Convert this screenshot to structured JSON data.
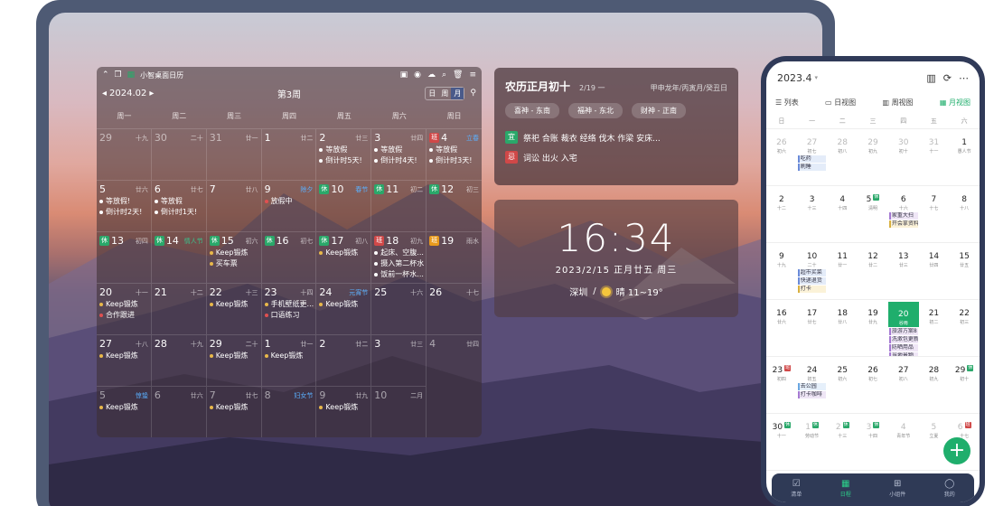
{
  "calendar": {
    "app_title": "小智桌面日历",
    "month": "2024.02",
    "week": "第3周",
    "view_tabs": [
      "日",
      "周",
      "月"
    ],
    "weekdays": [
      "周一",
      "周二",
      "周三",
      "周四",
      "周五",
      "周六",
      "周日"
    ],
    "cells": [
      {
        "d": "29",
        "l": "十九",
        "dim": true
      },
      {
        "d": "30",
        "l": "二十",
        "dim": true
      },
      {
        "d": "31",
        "l": "廿一",
        "dim": true
      },
      {
        "d": "1",
        "l": "廿二"
      },
      {
        "d": "2",
        "l": "廿三",
        "ev": [
          [
            "等放假",
            "w"
          ],
          [
            "倒计时5天!",
            "w"
          ]
        ]
      },
      {
        "d": "3",
        "l": "廿四",
        "ev": [
          [
            "等放假",
            "w"
          ],
          [
            "倒计时4天!",
            "w"
          ]
        ]
      },
      {
        "d": "4",
        "l": "立春",
        "fest": true,
        "tag": "班",
        "tc": "b",
        "ev": [
          [
            "等放假",
            "w"
          ],
          [
            "倒计时3天!",
            "w"
          ]
        ]
      },
      {
        "d": "5",
        "l": "廿六",
        "ev": [
          [
            "等放假!",
            "w"
          ],
          [
            "倒计时2天!",
            "w"
          ]
        ]
      },
      {
        "d": "6",
        "l": "廿七",
        "ev": [
          [
            "等放假",
            "w"
          ],
          [
            "倒计时1天!",
            "w"
          ]
        ]
      },
      {
        "d": "7",
        "l": "廿八"
      },
      {
        "d": "9",
        "l": "除夕",
        "fest": true,
        "ev": [
          [
            "放假中",
            "r"
          ]
        ]
      },
      {
        "d": "10",
        "l": "春节",
        "fest": true,
        "tag": "休",
        "tc": "x"
      },
      {
        "d": "11",
        "l": "初二",
        "tag": "休",
        "tc": "x"
      },
      {
        "d": "12",
        "l": "初三",
        "tag": "休",
        "tc": "x"
      },
      {
        "d": "13",
        "l": "初四",
        "tag": "休",
        "tc": "x"
      },
      {
        "d": "14",
        "l": "情人节",
        "fest2": true,
        "tag": "休",
        "tc": "x"
      },
      {
        "d": "15",
        "l": "初六",
        "tag": "休",
        "tc": "x",
        "ev": [
          [
            "Keep锻炼",
            ""
          ],
          [
            "买车票",
            ""
          ]
        ]
      },
      {
        "d": "16",
        "l": "初七",
        "tag": "休",
        "tc": "x"
      },
      {
        "d": "17",
        "l": "初八",
        "tag": "休",
        "tc": "x",
        "ev": [
          [
            "Keep锻炼",
            ""
          ]
        ]
      },
      {
        "d": "18",
        "l": "初九",
        "tag": "班",
        "tc": "b",
        "ev": [
          [
            "起床、空腹...",
            "w"
          ],
          [
            "摄入第二杯水",
            "w"
          ],
          [
            "饭前一杯水...",
            "w"
          ]
        ]
      },
      {
        "d": "19",
        "l": "雨水",
        "tag": "班",
        "tc": "o"
      },
      {
        "d": "20",
        "l": "十一",
        "ev": [
          [
            "Keep锻炼",
            ""
          ],
          [
            "合作跟进",
            "r"
          ]
        ]
      },
      {
        "d": "21",
        "l": "十二"
      },
      {
        "d": "22",
        "l": "十三",
        "ev": [
          [
            "Keep锻炼",
            ""
          ]
        ]
      },
      {
        "d": "23",
        "l": "十四",
        "ev": [
          [
            "手机壁纸更...",
            ""
          ],
          [
            "口语练习",
            "r"
          ]
        ]
      },
      {
        "d": "24",
        "l": "元宵节",
        "fest": true,
        "ev": [
          [
            "Keep锻炼",
            ""
          ]
        ]
      },
      {
        "d": "25",
        "l": "十六"
      },
      {
        "d": "26",
        "l": "十七"
      },
      {
        "d": "27",
        "l": "十八",
        "ev": [
          [
            "Keep锻炼",
            ""
          ]
        ]
      },
      {
        "d": "28",
        "l": "十九"
      },
      {
        "d": "29",
        "l": "二十",
        "ev": [
          [
            "Keep锻炼",
            ""
          ]
        ]
      },
      {
        "d": "1",
        "l": "廿一",
        "ev": [
          [
            "Keep锻炼",
            ""
          ]
        ]
      },
      {
        "d": "2",
        "l": "廿二"
      },
      {
        "d": "3",
        "l": "廿三"
      },
      {
        "d": "4",
        "l": "廿四",
        "dim": true
      },
      {
        "d": "5",
        "l": "惊蛰",
        "fest": true,
        "dim": true,
        "ev": [
          [
            "Keep锻炼",
            ""
          ]
        ]
      },
      {
        "d": "6",
        "l": "廿六",
        "dim": true
      },
      {
        "d": "7",
        "l": "廿七",
        "dim": true,
        "ev": [
          [
            "Keep锻炼",
            ""
          ]
        ]
      },
      {
        "d": "8",
        "l": "妇女节",
        "fest": true,
        "dim": true
      },
      {
        "d": "9",
        "l": "廿九",
        "dim": true,
        "ev": [
          [
            "Keep锻炼",
            ""
          ]
        ]
      },
      {
        "d": "10",
        "l": "二月",
        "dim": true
      }
    ]
  },
  "almanac": {
    "title": "农历正月初十",
    "date": "2/19 一",
    "ganzhi": "甲申龙年/丙寅月/癸丑日",
    "gods": [
      "喜神 - 东南",
      "福神 - 东北",
      "财神 - 正南"
    ],
    "yi_label": "宜",
    "yi": "祭祀 合账 裁衣 经络 伐木 作梁 安床...",
    "ji_label": "忌",
    "ji": "词讼 出火 入宅"
  },
  "clock": {
    "time": "16:34",
    "date": "2023/2/15   正月廿五   周三",
    "city": "深圳",
    "sep": "/",
    "weather": "晴 11~19°"
  },
  "phone": {
    "month": "2023.4",
    "views": [
      "列表",
      "日视图",
      "周视图",
      "月视图"
    ],
    "weekdays": [
      "日",
      "一",
      "二",
      "三",
      "四",
      "五",
      "六"
    ],
    "nav": [
      "清单",
      "日程",
      "小组件",
      "我的"
    ],
    "fab": "+",
    "cells": [
      {
        "d": "26",
        "l": "初六",
        "dim": true
      },
      {
        "d": "27",
        "l": "初七",
        "dim": true,
        "ev": [
          [
            "吃药",
            "blue"
          ],
          [
            "刷睡",
            "blue"
          ]
        ]
      },
      {
        "d": "28",
        "l": "初八",
        "dim": true
      },
      {
        "d": "29",
        "l": "初九",
        "dim": true
      },
      {
        "d": "30",
        "l": "初十",
        "dim": true
      },
      {
        "d": "31",
        "l": "十一",
        "dim": true
      },
      {
        "d": "1",
        "l": "愚人节"
      },
      {
        "d": "2",
        "l": "十二"
      },
      {
        "d": "3",
        "l": "十三"
      },
      {
        "d": "4",
        "l": "十四"
      },
      {
        "d": "5",
        "l": "清明",
        "b": "休",
        "bc": "x"
      },
      {
        "d": "6",
        "l": "十六",
        "ev": [
          [
            "家重大扫",
            "pur"
          ],
          [
            "开会拿资料",
            "yel"
          ]
        ]
      },
      {
        "d": "7",
        "l": "十七"
      },
      {
        "d": "8",
        "l": "十八"
      },
      {
        "d": "9",
        "l": "十九"
      },
      {
        "d": "10",
        "l": "二十",
        "ev": [
          [
            "超市买菜",
            "blue"
          ],
          [
            "快递退货",
            "blue"
          ],
          [
            "打卡",
            "yel"
          ]
        ]
      },
      {
        "d": "11",
        "l": "廿一"
      },
      {
        "d": "12",
        "l": "廿二"
      },
      {
        "d": "13",
        "l": "廿三"
      },
      {
        "d": "14",
        "l": "廿四"
      },
      {
        "d": "15",
        "l": "廿五"
      },
      {
        "d": "16",
        "l": "廿六"
      },
      {
        "d": "17",
        "l": "廿七"
      },
      {
        "d": "18",
        "l": "廿八"
      },
      {
        "d": "19",
        "l": "廿九"
      },
      {
        "d": "20",
        "l": "谷雨",
        "today": true,
        "ev": [
          [
            "旅游方案8",
            "pur"
          ],
          [
            "洗漱包更新",
            "pur"
          ],
          [
            "防晒用品",
            "pur"
          ],
          [
            "当地景物",
            "pur"
          ]
        ]
      },
      {
        "d": "21",
        "l": "初二"
      },
      {
        "d": "22",
        "l": "初三"
      },
      {
        "d": "23",
        "l": "初四",
        "b": "班",
        "bc": "b"
      },
      {
        "d": "24",
        "l": "初五",
        "ev": [
          [
            "去公园",
            "ltb"
          ],
          [
            "打卡咖啡",
            "pur"
          ]
        ]
      },
      {
        "d": "25",
        "l": "初六"
      },
      {
        "d": "26",
        "l": "初七"
      },
      {
        "d": "27",
        "l": "初八"
      },
      {
        "d": "28",
        "l": "初九"
      },
      {
        "d": "29",
        "l": "初十",
        "b": "休",
        "bc": "x"
      },
      {
        "d": "30",
        "l": "十一",
        "b": "休",
        "bc": "x"
      },
      {
        "d": "1",
        "l": "劳动节",
        "dim": true,
        "b": "休",
        "bc": "x"
      },
      {
        "d": "2",
        "l": "十三",
        "dim": true,
        "b": "休",
        "bc": "x"
      },
      {
        "d": "3",
        "l": "十四",
        "dim": true,
        "b": "休",
        "bc": "x"
      },
      {
        "d": "4",
        "l": "青年节",
        "dim": true
      },
      {
        "d": "5",
        "l": "立夏",
        "dim": true
      },
      {
        "d": "6",
        "l": "十七",
        "dim": true,
        "b": "班",
        "bc": "b"
      }
    ]
  },
  "colors": {
    "accent": "#1fae6c",
    "holiday": "#2aa86a",
    "workday": "#d04848"
  }
}
